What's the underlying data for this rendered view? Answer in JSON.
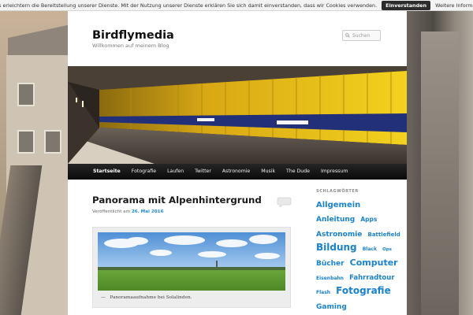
{
  "cookie_bar": {
    "message": "Cookies erleichtern die Bereitstellung unserer Dienste. Mit der Nutzung unserer Dienste erklären Sie sich damit einverstanden, dass wir Cookies verwenden.",
    "accept_label": "Einverstanden",
    "more_label": "Weitere Informationen"
  },
  "site": {
    "title": "Birdflymedia",
    "description": "Willkommen auf meinem Blog"
  },
  "search": {
    "placeholder": "Suchen"
  },
  "nav": {
    "items": [
      "Startseite",
      "Fotografie",
      "Laufen",
      "Twitter",
      "Astronomie",
      "Musik",
      "The Dude",
      "Impressum"
    ],
    "active": "Startseite"
  },
  "hero": {
    "station_sign_1": "Heimplatz",
    "station_sign_2": "Heizkraftwerk"
  },
  "post": {
    "title": "Panorama mit Alpenhintergrund",
    "meta_prefix": "Veröffentlicht am",
    "date": "26. Mai 2016",
    "caption_dash": "—",
    "caption": "Panoramaaufnahme bei Solalinden."
  },
  "sidebar": {
    "widget_title": "SCHLAGWÖRTER",
    "tags": [
      {
        "label": "Allgemein",
        "size": 10
      },
      {
        "label": "Anleitung",
        "size": 9
      },
      {
        "label": "Apps",
        "size": 7.5
      },
      {
        "label": "Astronomie",
        "size": 9
      },
      {
        "label": "Battlefield",
        "size": 7
      },
      {
        "label": "Bildung",
        "size": 12
      },
      {
        "label": "Black",
        "size": 6
      },
      {
        "label": "Ops",
        "size": 5.5
      },
      {
        "label": "Bücher",
        "size": 9
      },
      {
        "label": "Computer",
        "size": 11
      },
      {
        "label": "Eisenbahn",
        "size": 6
      },
      {
        "label": "Fahrradtour",
        "size": 8.5
      },
      {
        "label": "Flash",
        "size": 6
      },
      {
        "label": "Fotografie",
        "size": 12
      },
      {
        "label": "Gaming",
        "size": 9
      }
    ]
  },
  "colors": {
    "link": "#1982d1",
    "nav_bg": "#111111",
    "hero_yellow": "#e8c21a",
    "hero_stripe": "#2a3a7a"
  }
}
